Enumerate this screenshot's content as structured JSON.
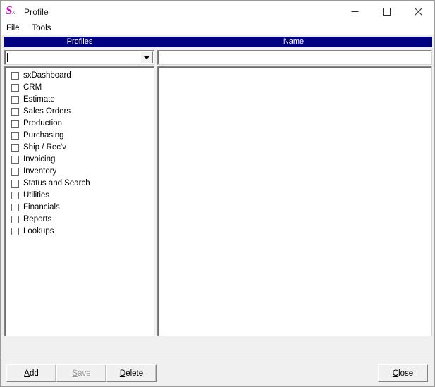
{
  "window": {
    "title": "Profile",
    "icon": "sx-app-icon",
    "controls": [
      {
        "name": "minimize",
        "glyph": "minimize-icon"
      },
      {
        "name": "maximize",
        "glyph": "maximize-icon"
      },
      {
        "name": "close",
        "glyph": "close-icon"
      }
    ]
  },
  "menubar": {
    "items": [
      {
        "label": "File"
      },
      {
        "label": "Tools"
      }
    ]
  },
  "columns": {
    "profiles_header": "Profiles",
    "name_header": "Name",
    "header_background": "#000080",
    "header_text_color": "#ffffff"
  },
  "profiles_combo": {
    "value": "",
    "placeholder": "",
    "dropdown_icon": "chevron-down-icon"
  },
  "name_field": {
    "value": "",
    "placeholder": ""
  },
  "profiles_list": {
    "items": [
      {
        "label": "sxDashboard",
        "checked": false
      },
      {
        "label": "CRM",
        "checked": false
      },
      {
        "label": "Estimate",
        "checked": false
      },
      {
        "label": "Sales Orders",
        "checked": false
      },
      {
        "label": "Production",
        "checked": false
      },
      {
        "label": "Purchasing",
        "checked": false
      },
      {
        "label": "Ship / Rec'v",
        "checked": false
      },
      {
        "label": "Invoicing",
        "checked": false
      },
      {
        "label": "Inventory",
        "checked": false
      },
      {
        "label": "Status and Search",
        "checked": false
      },
      {
        "label": "Utilities",
        "checked": false
      },
      {
        "label": "Financials",
        "checked": false
      },
      {
        "label": "Reports",
        "checked": false
      },
      {
        "label": "Lookups",
        "checked": false
      }
    ]
  },
  "name_list": {
    "items": []
  },
  "footer": {
    "add": {
      "accel": "A",
      "rest": "dd",
      "enabled": true
    },
    "save": {
      "accel": "S",
      "rest": "ave",
      "enabled": false
    },
    "delete": {
      "accel": "D",
      "rest": "elete",
      "enabled": true
    },
    "close": {
      "accel": "C",
      "rest": "lose",
      "enabled": true
    }
  }
}
